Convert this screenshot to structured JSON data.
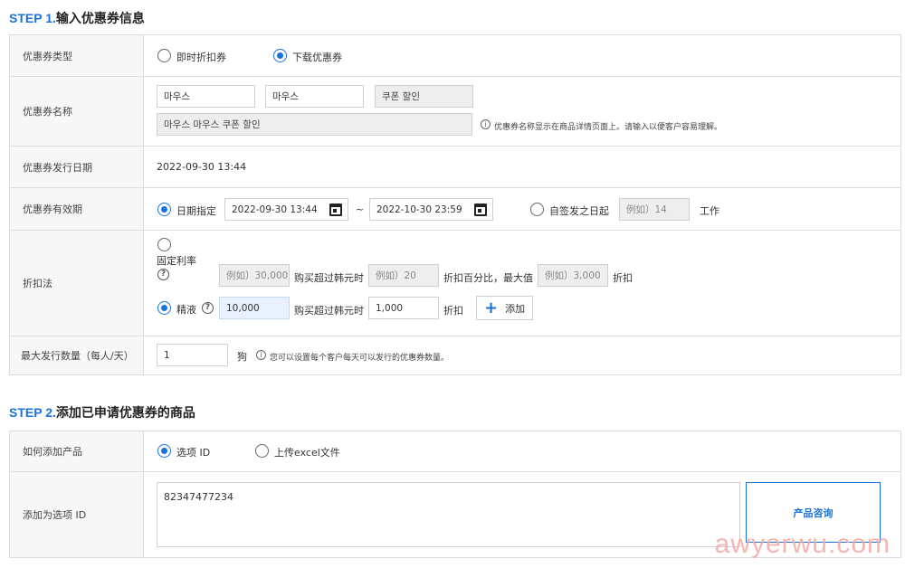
{
  "step1": {
    "num": "STEP 1.",
    "title": "输入优惠券信息",
    "coupon_type": {
      "label": "优惠券类型",
      "opt_instant": "即时折扣券",
      "opt_download": "下载优惠券",
      "selected": "download"
    },
    "coupon_name": {
      "label": "优惠券名称",
      "field1": "마우스",
      "field2": "마우스",
      "field3": "쿠폰 할인",
      "combined": "마우스 마우스 쿠폰 할인",
      "hint": "优惠券名称显示在商品详情页面上。请输入以便客户容易理解。"
    },
    "issue_date": {
      "label": "优惠券发行日期",
      "value": "2022-09-30 13:44"
    },
    "validity": {
      "label": "优惠券有效期",
      "opt_date": "日期指定",
      "start": "2022-09-30 13:44",
      "separator": "~",
      "end": "2022-10-30 23:59",
      "opt_from_issue": "自签发之日起",
      "days_placeholder": "例如）14",
      "unit": "工作"
    },
    "discount": {
      "label": "折扣法",
      "opt_fixed_rate": "固定利率",
      "rate_min_placeholder": "例如）30,000",
      "rate_text_buy": "购买超过韩元时",
      "rate_pct_placeholder": "例如）20",
      "rate_text_pct": "折扣百分比，最大值",
      "rate_max_placeholder": "例如）3,000",
      "rate_text_discount": "折扣",
      "opt_exact": "精液",
      "exact_min_value": "10,000",
      "exact_text_buy": "购买超过韩元时",
      "exact_amount_value": "1,000",
      "exact_text_discount": "折扣",
      "add_label": "添加"
    },
    "max_issue": {
      "label": "最大发行数量（每人/天）",
      "value": "1",
      "unit": "狗",
      "hint": "您可以设置每个客户每天可以发行的优惠券数量。"
    }
  },
  "step2": {
    "num": "STEP 2.",
    "title": "添加已申请优惠券的商品",
    "how_add": {
      "label": "如何添加产品",
      "opt_option_id": "选项 ID",
      "opt_excel": "上传excel文件",
      "selected": "option_id"
    },
    "add_ids": {
      "label": "添加为选项 ID",
      "value": "82347477234",
      "query_button": "产品咨询"
    }
  },
  "watermark": "awyerwu.com",
  "colors": {
    "accent": "#1a73d9",
    "label_bg": "#f7f7f7",
    "border": "#dcdcdc",
    "disabled_bg": "#eeeeee",
    "active_input_bg": "#e8f1fd",
    "watermark": "#f4a9a4"
  }
}
